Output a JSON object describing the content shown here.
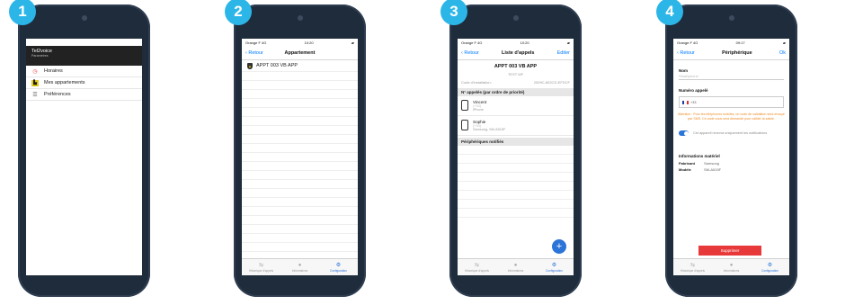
{
  "step_badges": [
    "1",
    "2",
    "3",
    "4"
  ],
  "colors": {
    "badge": "#2cb6e8",
    "phone_frame": "#1f2c3c",
    "accent_blue": "#2b74d8",
    "warning_orange": "#f08a24",
    "delete_red": "#e8393a"
  },
  "status_bar": {
    "carrier": "Orange F  4G",
    "time_2": "10:20",
    "time_3": "10:20",
    "time_4": "09:17"
  },
  "tabbar": {
    "tabs": [
      {
        "label": "Historique d'appels",
        "icon": "history-icon"
      },
      {
        "label": "Informations",
        "icon": "info-icon"
      },
      {
        "label": "Configuration",
        "icon": "config-icon"
      }
    ]
  },
  "screen1": {
    "app_title": "Tel2voice",
    "subtitle": "Paramètres",
    "menu": [
      {
        "label": "Horaires",
        "icon": "clock-icon"
      },
      {
        "label": "Mes appartements",
        "icon": "building-icon"
      },
      {
        "label": "Préférences",
        "icon": "sliders-icon"
      }
    ]
  },
  "screen2": {
    "back": "Retour",
    "title": "Appartement",
    "item": "APPT 003 VB APP"
  },
  "screen3": {
    "back": "Retour",
    "title": "Liste d'appels",
    "edit": "Editer",
    "apt_name": "APPT 003 VB APP",
    "apt_sub": "TEST MF",
    "install_label": "Code d'installation:",
    "install_code": "2009C-802CD-EFDCF",
    "section_called": "N° appelés (par ordre de priorité)",
    "contacts": [
      {
        "name": "Vincent",
        "number": "(+33)",
        "device": "iPhone"
      },
      {
        "name": "Sophie",
        "number": "(+33)",
        "device": "Samsung, SM-A515F"
      }
    ],
    "section_devices": "Périphériques notifiés",
    "fab": "+"
  },
  "screen4": {
    "back": "Retour",
    "title": "Périphérique",
    "ok": "Ok",
    "name_label": "Nom",
    "name_placeholder": "Smartphone",
    "number_label": "Numéro appelé",
    "prefix": "+33",
    "warning": "Attention : Pour les téléphones mobiles, un code de validation sera envoyé par SMS. Ce code vous sera demandé pour valider la saisie.",
    "toggle_text": "Cet appareil recevra uniquement les notifications",
    "info_title": "Informations matériel",
    "manufacturer_label": "Fabricant",
    "manufacturer": "Samsung",
    "model_label": "Modèle",
    "model": "SM-A515F",
    "delete": "Supprimer"
  }
}
